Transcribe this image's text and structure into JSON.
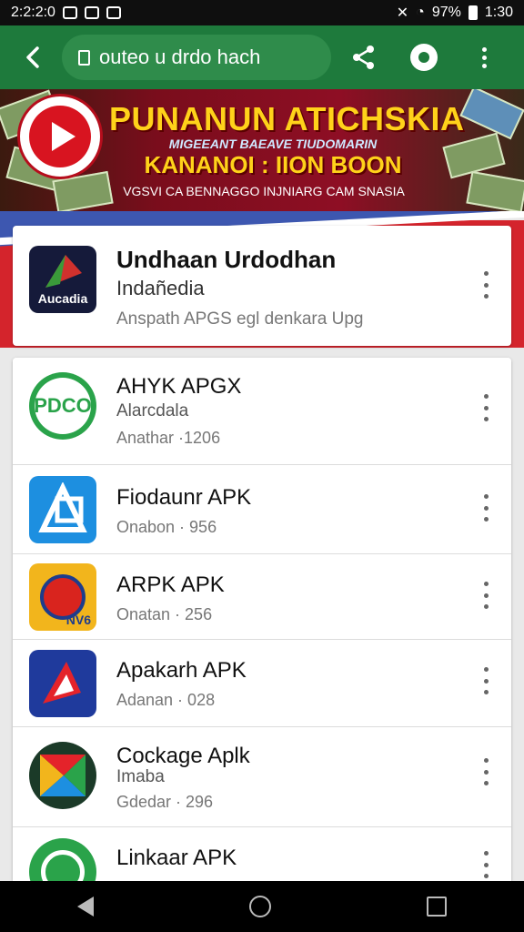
{
  "status_bar": {
    "time": "2:2:2:0",
    "battery": "97%",
    "clock_right": "1:30"
  },
  "browser": {
    "url": "outeo u drdo hach"
  },
  "banner": {
    "title": "PUNANUN ATICHSKIA",
    "line1": "MIGEEANT BAEAVE TIUDOMARIN",
    "line2": "KANANOI : IION BOON",
    "line3": "VGSVI CA BENNAGGO   INJNIARG CAM SNASIA"
  },
  "featured": {
    "title": "Undhaan Urdodhan",
    "subtitle": "Indañedia",
    "description": "Anspath APGS egl denkara Upg",
    "icon_label": "Aucadia"
  },
  "apps": [
    {
      "title": "AHYK APGX",
      "subtitle": "Alarcdala",
      "meta": "Anathar  ·1206",
      "icon_text": "PDCO",
      "icon": "circle-arrows-icon"
    },
    {
      "title": "Fiodaunr APK",
      "subtitle": "",
      "meta": "Onabon  ·  956",
      "icon_text": "",
      "icon": "ap-logo-icon"
    },
    {
      "title": "ARPK APK",
      "subtitle": "",
      "meta": "Onatan  ·  256",
      "icon_text": "NV6",
      "icon": "yellow-badge-icon"
    },
    {
      "title": "Apakarh APK",
      "subtitle": "",
      "meta": "Adanan  ·  028",
      "icon_text": "",
      "icon": "red-triangle-icon"
    },
    {
      "title": "Cockage Aplk",
      "subtitle": "Imaba",
      "meta": "Gdedar  ·  296",
      "icon_text": "",
      "icon": "colorful-x-icon"
    },
    {
      "title": "Linkaar APK",
      "subtitle": "",
      "meta": "",
      "icon_text": "",
      "icon": "green-circle-icon"
    }
  ],
  "colors": {
    "toolbar": "#1e7a3c",
    "banner_text": "#ffd21a",
    "accent_red": "#d4242c"
  }
}
